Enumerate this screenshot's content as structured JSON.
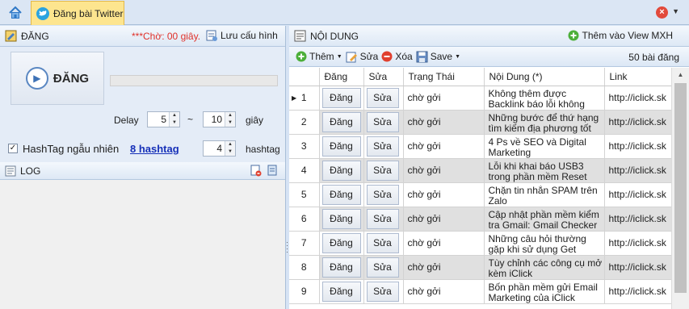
{
  "tab": {
    "label": "Đăng bài Twitter"
  },
  "left": {
    "header_title": "ĐĂNG",
    "wait_text": "***Chờ: 00 giây.",
    "save_config_label": "Lưu cấu hình",
    "post_button_label": "ĐĂNG",
    "delay_label": "Delay",
    "delay_from": "5",
    "delay_tilde": "~",
    "delay_to": "10",
    "delay_unit": "giây",
    "hashtag_checkbox_label": "HashTag ngẫu nhiên",
    "hashtag_checked": true,
    "hashtag_link": "8 hashtag",
    "hashtag_count": "4",
    "hashtag_unit": "hashtag",
    "log_title": "LOG"
  },
  "right": {
    "header_title": "NỘI DUNG",
    "add_view_label": "Thêm vào View MXH",
    "toolbar": {
      "add": "Thêm",
      "edit": "Sửa",
      "delete": "Xóa",
      "save": "Save"
    },
    "post_count": "50 bài đăng",
    "columns": [
      "Đăng",
      "Sửa",
      "Trạng Thái",
      "Nội Dung (*)",
      "Link"
    ],
    "rows": [
      {
        "no": "1",
        "post": "Đăng",
        "edit": "Sửa",
        "status": "chờ gởi",
        "content": "Không thêm được Backlink báo lỗi không",
        "link": "http://iclick.sk"
      },
      {
        "no": "2",
        "post": "Đăng",
        "edit": "Sửa",
        "status": "chờ gởi",
        "content": "Những bước để thứ hạng tìm kiếm địa phương tốt",
        "link": "http://iclick.sk"
      },
      {
        "no": "3",
        "post": "Đăng",
        "edit": "Sửa",
        "status": "chờ gởi",
        "content": "4 Ps về SEO và Digital Marketing",
        "link": "http://iclick.sk"
      },
      {
        "no": "4",
        "post": "Đăng",
        "edit": "Sửa",
        "status": "chờ gởi",
        "content": "Lỗi khi khai báo USB3 trong phần mềm Reset",
        "link": "http://iclick.sk"
      },
      {
        "no": "5",
        "post": "Đăng",
        "edit": "Sửa",
        "status": "chờ gởi",
        "content": "Chặn tin nhắn SPAM trên Zalo",
        "link": "http://iclick.sk"
      },
      {
        "no": "6",
        "post": "Đăng",
        "edit": "Sửa",
        "status": "chờ gởi",
        "content": "Cập nhật phần mềm kiểm tra Gmail: Gmail Checker",
        "link": "http://iclick.sk"
      },
      {
        "no": "7",
        "post": "Đăng",
        "edit": "Sửa",
        "status": "chờ gởi",
        "content": "Những câu hỏi thường gặp khi sử dụng Get",
        "link": "http://iclick.sk"
      },
      {
        "no": "8",
        "post": "Đăng",
        "edit": "Sửa",
        "status": "chờ gởi",
        "content": "Tùy chỉnh các công cụ mở kèm iClick",
        "link": "http://iclick.sk"
      },
      {
        "no": "9",
        "post": "Đăng",
        "edit": "Sửa",
        "status": "chờ gởi",
        "content": "Bốn phần mềm gửi Email Marketing của iClick",
        "link": "http://iclick.sk"
      }
    ]
  }
}
